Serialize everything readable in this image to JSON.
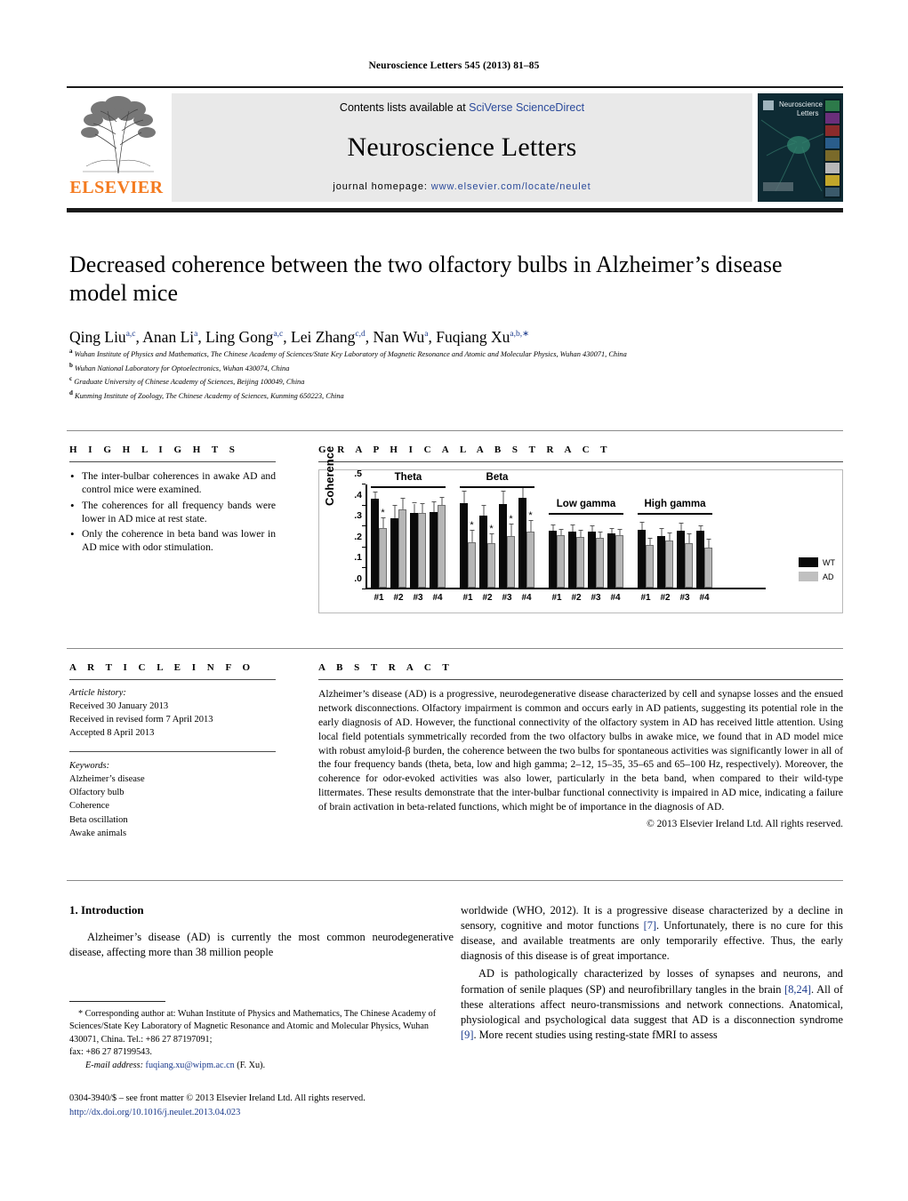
{
  "running_head": "Neuroscience Letters 545 (2013) 81–85",
  "masthead": {
    "contents_prefix": "Contents lists available at ",
    "contents_link": "SciVerse ScienceDirect",
    "journal_title": "Neuroscience Letters",
    "homepage_prefix": "journal homepage: ",
    "homepage_url": "www.elsevier.com/locate/neulet",
    "publisher": "ELSEVIER",
    "cover_title": "Neuroscience Letters"
  },
  "article": {
    "title": "Decreased coherence between the two olfactory bulbs in Alzheimer’s disease model mice",
    "authors": [
      {
        "name": "Qing Liu",
        "sup": "a,c"
      },
      {
        "name": "Anan Li",
        "sup": "a"
      },
      {
        "name": "Ling Gong",
        "sup": "a,c"
      },
      {
        "name": "Lei Zhang",
        "sup": "c,d"
      },
      {
        "name": "Nan Wu",
        "sup": "a"
      },
      {
        "name": "Fuqiang Xu",
        "sup": "a,b,∗"
      }
    ],
    "affiliations": [
      {
        "marker": "a",
        "text": "Wuhan Institute of Physics and Mathematics, The Chinese Academy of Sciences/State Key Laboratory of Magnetic Resonance and Atomic and Molecular Physics, Wuhan 430071, China"
      },
      {
        "marker": "b",
        "text": "Wuhan National Laboratory for Optoelectronics, Wuhan 430074, China"
      },
      {
        "marker": "c",
        "text": "Graduate University of Chinese Academy of Sciences, Beijing 100049, China"
      },
      {
        "marker": "d",
        "text": "Kunming Institute of Zoology, The Chinese Academy of Sciences, Kunming 650223, China"
      }
    ]
  },
  "highlights": {
    "heading": "H I G H L I G H T S",
    "items": [
      "The inter-bulbar coherences in awake AD and control mice were examined.",
      "The coherences for all frequency bands were lower in AD mice at rest state.",
      "Only the coherence in beta band was lower in AD mice with odor stimulation."
    ]
  },
  "graphical_abstract": {
    "heading": "G R A P H I C A L   A B S T R A C T"
  },
  "chart_data": {
    "type": "bar",
    "title": "",
    "ylabel": "Coherence",
    "xlabel": "",
    "ylim": [
      0,
      0.5
    ],
    "yticks": [
      ".0",
      ".1",
      ".2",
      ".3",
      ".4",
      ".5"
    ],
    "ytick_values": [
      0.0,
      0.1,
      0.2,
      0.3,
      0.4,
      0.5
    ],
    "grid": false,
    "legend_position": "right",
    "legend": [
      {
        "name": "WT",
        "color": "#0a0a0a"
      },
      {
        "name": "AD",
        "color": "#c0c0c0"
      }
    ],
    "band_labels": [
      "Theta",
      "Beta",
      "Low gamma",
      "High gamma"
    ],
    "categories": [
      "#1",
      "#2",
      "#3",
      "#4"
    ],
    "groups": [
      {
        "band": "Theta",
        "subjects": [
          "#1",
          "#2",
          "#3",
          "#4"
        ],
        "wt": [
          0.43,
          0.336,
          0.362,
          0.367
        ],
        "wt_err": [
          0.03,
          0.06,
          0.045,
          0.045
        ],
        "ad": [
          0.289,
          0.378,
          0.36,
          0.402
        ],
        "ad_err": [
          0.045,
          0.052,
          0.045,
          0.035
        ],
        "significant": [
          true,
          false,
          false,
          false
        ]
      },
      {
        "band": "Beta",
        "subjects": [
          "#1",
          "#2",
          "#3",
          "#4"
        ],
        "wt": [
          0.409,
          0.35,
          0.404,
          0.434
        ],
        "wt_err": [
          0.055,
          0.045,
          0.06,
          0.055
        ],
        "ad": [
          0.218,
          0.214,
          0.249,
          0.271
        ],
        "ad_err": [
          0.055,
          0.045,
          0.055,
          0.05
        ],
        "significant": [
          true,
          true,
          true,
          true
        ]
      },
      {
        "band": "Low gamma",
        "subjects": [
          "#1",
          "#2",
          "#3",
          "#4"
        ],
        "wt": [
          0.274,
          0.272,
          0.269,
          0.261
        ],
        "wt_err": [
          0.028,
          0.028,
          0.028,
          0.024
        ],
        "ad": [
          0.253,
          0.245,
          0.24,
          0.252
        ],
        "ad_err": [
          0.028,
          0.028,
          0.028,
          0.028
        ],
        "significant": [
          false,
          false,
          false,
          false
        ]
      },
      {
        "band": "High gamma",
        "subjects": [
          "#1",
          "#2",
          "#3",
          "#4"
        ],
        "wt": [
          0.279,
          0.248,
          0.276,
          0.277
        ],
        "wt_err": [
          0.035,
          0.034,
          0.035,
          0.02
        ],
        "ad": [
          0.205,
          0.229,
          0.213,
          0.191
        ],
        "ad_err": [
          0.03,
          0.035,
          0.045,
          0.04
        ],
        "significant": [
          false,
          false,
          false,
          false
        ]
      }
    ]
  },
  "article_info": {
    "heading": "A R T I C L E   I N F O",
    "history_label": "Article history:",
    "history": [
      "Received 30 January 2013",
      "Received in revised form 7 April 2013",
      "Accepted 8 April 2013"
    ],
    "keywords_label": "Keywords:",
    "keywords": [
      "Alzheimer’s disease",
      "Olfactory bulb",
      "Coherence",
      "Beta oscillation",
      "Awake animals"
    ]
  },
  "abstract": {
    "heading": "A B S T R A C T",
    "text": "Alzheimer’s disease (AD) is a progressive, neurodegenerative disease characterized by cell and synapse losses and the ensued network disconnections. Olfactory impairment is common and occurs early in AD patients, suggesting its potential role in the early diagnosis of AD. However, the functional connectivity of the olfactory system in AD has received little attention. Using local field potentials symmetrically recorded from the two olfactory bulbs in awake mice, we found that in AD model mice with robust amyloid-β burden, the coherence between the two bulbs for spontaneous activities was significantly lower in all of the four frequency bands (theta, beta, low and high gamma; 2–12, 15–35, 35–65 and 65–100 Hz, respectively). Moreover, the coherence for odor-evoked activities was also lower, particularly in the beta band, when compared to their wild-type littermates. These results demonstrate that the inter-bulbar functional connectivity is impaired in AD mice, indicating a failure of brain activation in beta-related functions, which might be of importance in the diagnosis of AD.",
    "copyright": "© 2013 Elsevier Ireland Ltd. All rights reserved."
  },
  "body": {
    "section_number_title": "1.  Introduction",
    "left_paragraph": "Alzheimer’s disease (AD) is currently the most common neurodegenerative disease, affecting more than 38 million people",
    "right_paragraph_1_a": "worldwide (WHO, 2012). It is a progressive disease characterized by a decline in sensory, cognitive and motor functions ",
    "right_paragraph_1_ref": "[7]",
    "right_paragraph_1_b": ". Unfortunately, there is no cure for this disease, and available treatments are only temporarily effective. Thus, the early diagnosis of this disease is of great importance.",
    "right_paragraph_2_a": "AD is pathologically characterized by losses of synapses and neurons, and formation of senile plaques (SP) and neurofibrillary tangles in the brain ",
    "right_paragraph_2_ref1": "[8,24]",
    "right_paragraph_2_b": ". All of these alterations affect neuro-transmissions and network connections. Anatomical, physiological and psychological data suggest that AD is a disconnection syndrome ",
    "right_paragraph_2_ref2": "[9]",
    "right_paragraph_2_c": ". More recent studies using resting-state fMRI to assess"
  },
  "footnote": {
    "corresponding": "* Corresponding author at: Wuhan Institute of Physics and Mathematics, The Chinese Academy of Sciences/State Key Laboratory of Magnetic Resonance and Atomic and Molecular Physics, Wuhan 430071, China. Tel.: +86 27 87197091;",
    "fax": "fax: +86 27 87199543.",
    "email_label": "E-mail address:",
    "email": "fuqiang.xu@wipm.ac.cn",
    "email_suffix": "(F. Xu)."
  },
  "imprint": {
    "line1": "0304-3940/$ – see front matter © 2013 Elsevier Ireland Ltd. All rights reserved.",
    "doi": "http://dx.doi.org/10.1016/j.neulet.2013.04.023"
  }
}
